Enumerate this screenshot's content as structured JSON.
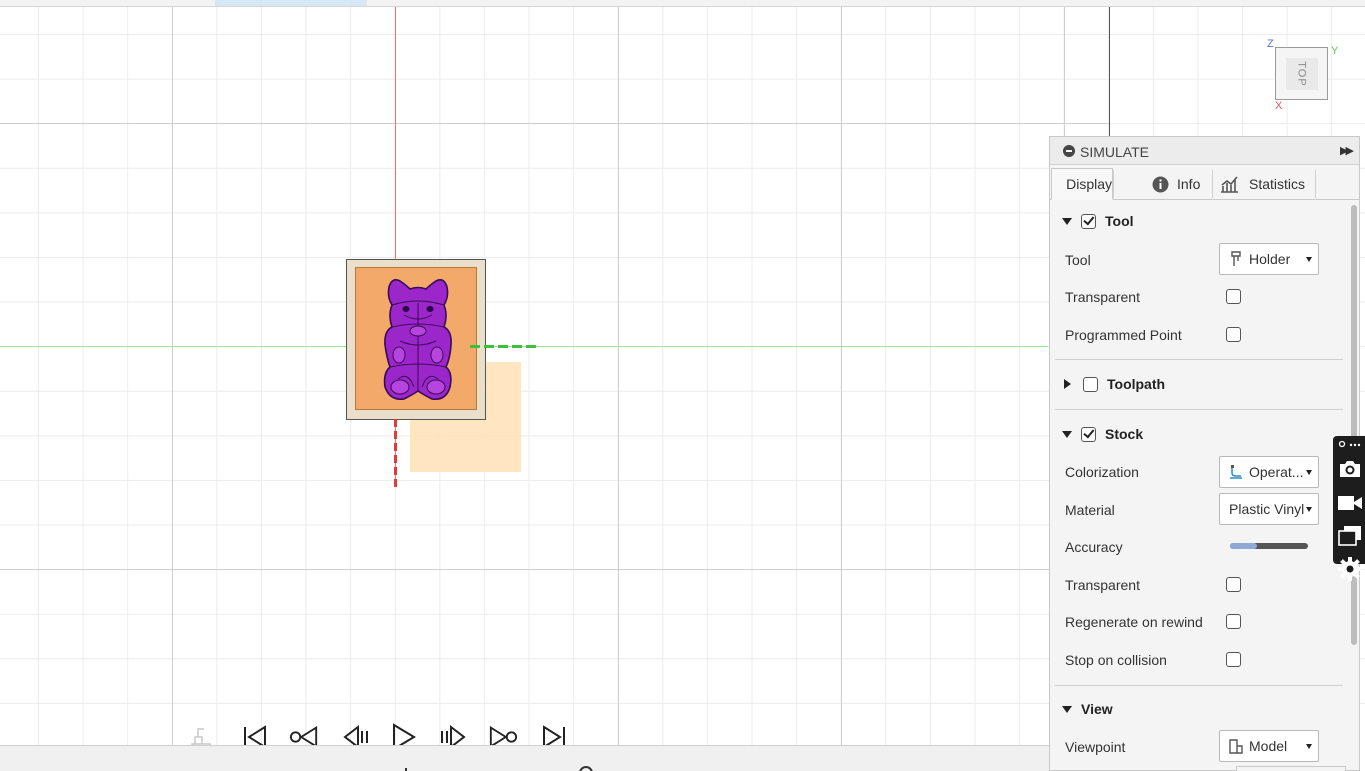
{
  "viewcube": {
    "face_label": "TOP",
    "axis_z": "Z",
    "axis_y": "Y",
    "axis_x": "X"
  },
  "simulate_panel": {
    "title": "SIMULATE",
    "tabs": [
      {
        "label": "Display",
        "icon": "eye-icon",
        "active": true
      },
      {
        "label": "Info",
        "icon": "info-icon",
        "active": false
      },
      {
        "label": "Statistics",
        "icon": "chart-icon",
        "active": false
      }
    ],
    "tool_group": {
      "title": "Tool",
      "expanded": true,
      "checked": true,
      "tool_label": "Tool",
      "tool_value": "Holder",
      "transparent_label": "Transparent",
      "transparent_checked": false,
      "programmed_point_label": "Programmed Point",
      "programmed_point_checked": false
    },
    "toolpath_group": {
      "title": "Toolpath",
      "expanded": false,
      "checked": false
    },
    "stock_group": {
      "title": "Stock",
      "expanded": true,
      "checked": true,
      "colorization_label": "Colorization",
      "colorization_value": "Operat...",
      "material_label": "Material",
      "material_value": "Plastic Vinyl",
      "accuracy_label": "Accuracy",
      "accuracy_level": 0.35,
      "transparent_label": "Transparent",
      "transparent_checked": false,
      "regenerate_label": "Regenerate on rewind",
      "regenerate_checked": false,
      "stop_collision_label": "Stop on collision",
      "stop_collision_checked": false
    },
    "view_group": {
      "title": "View",
      "expanded": true,
      "viewpoint_label": "Viewpoint",
      "viewpoint_value": "Model"
    }
  },
  "playback": {
    "buttons": [
      "go-to-start",
      "previous-operation",
      "step-back",
      "play",
      "step-forward",
      "next-operation",
      "go-to-end"
    ]
  },
  "colors": {
    "stock": "#f2a969",
    "part": "#9b26c9",
    "fixture": "#e9dfca",
    "x_axis": "#ff6a6a",
    "y_axis": "#9ee69e",
    "slider_fill": "#8fa8d8"
  }
}
